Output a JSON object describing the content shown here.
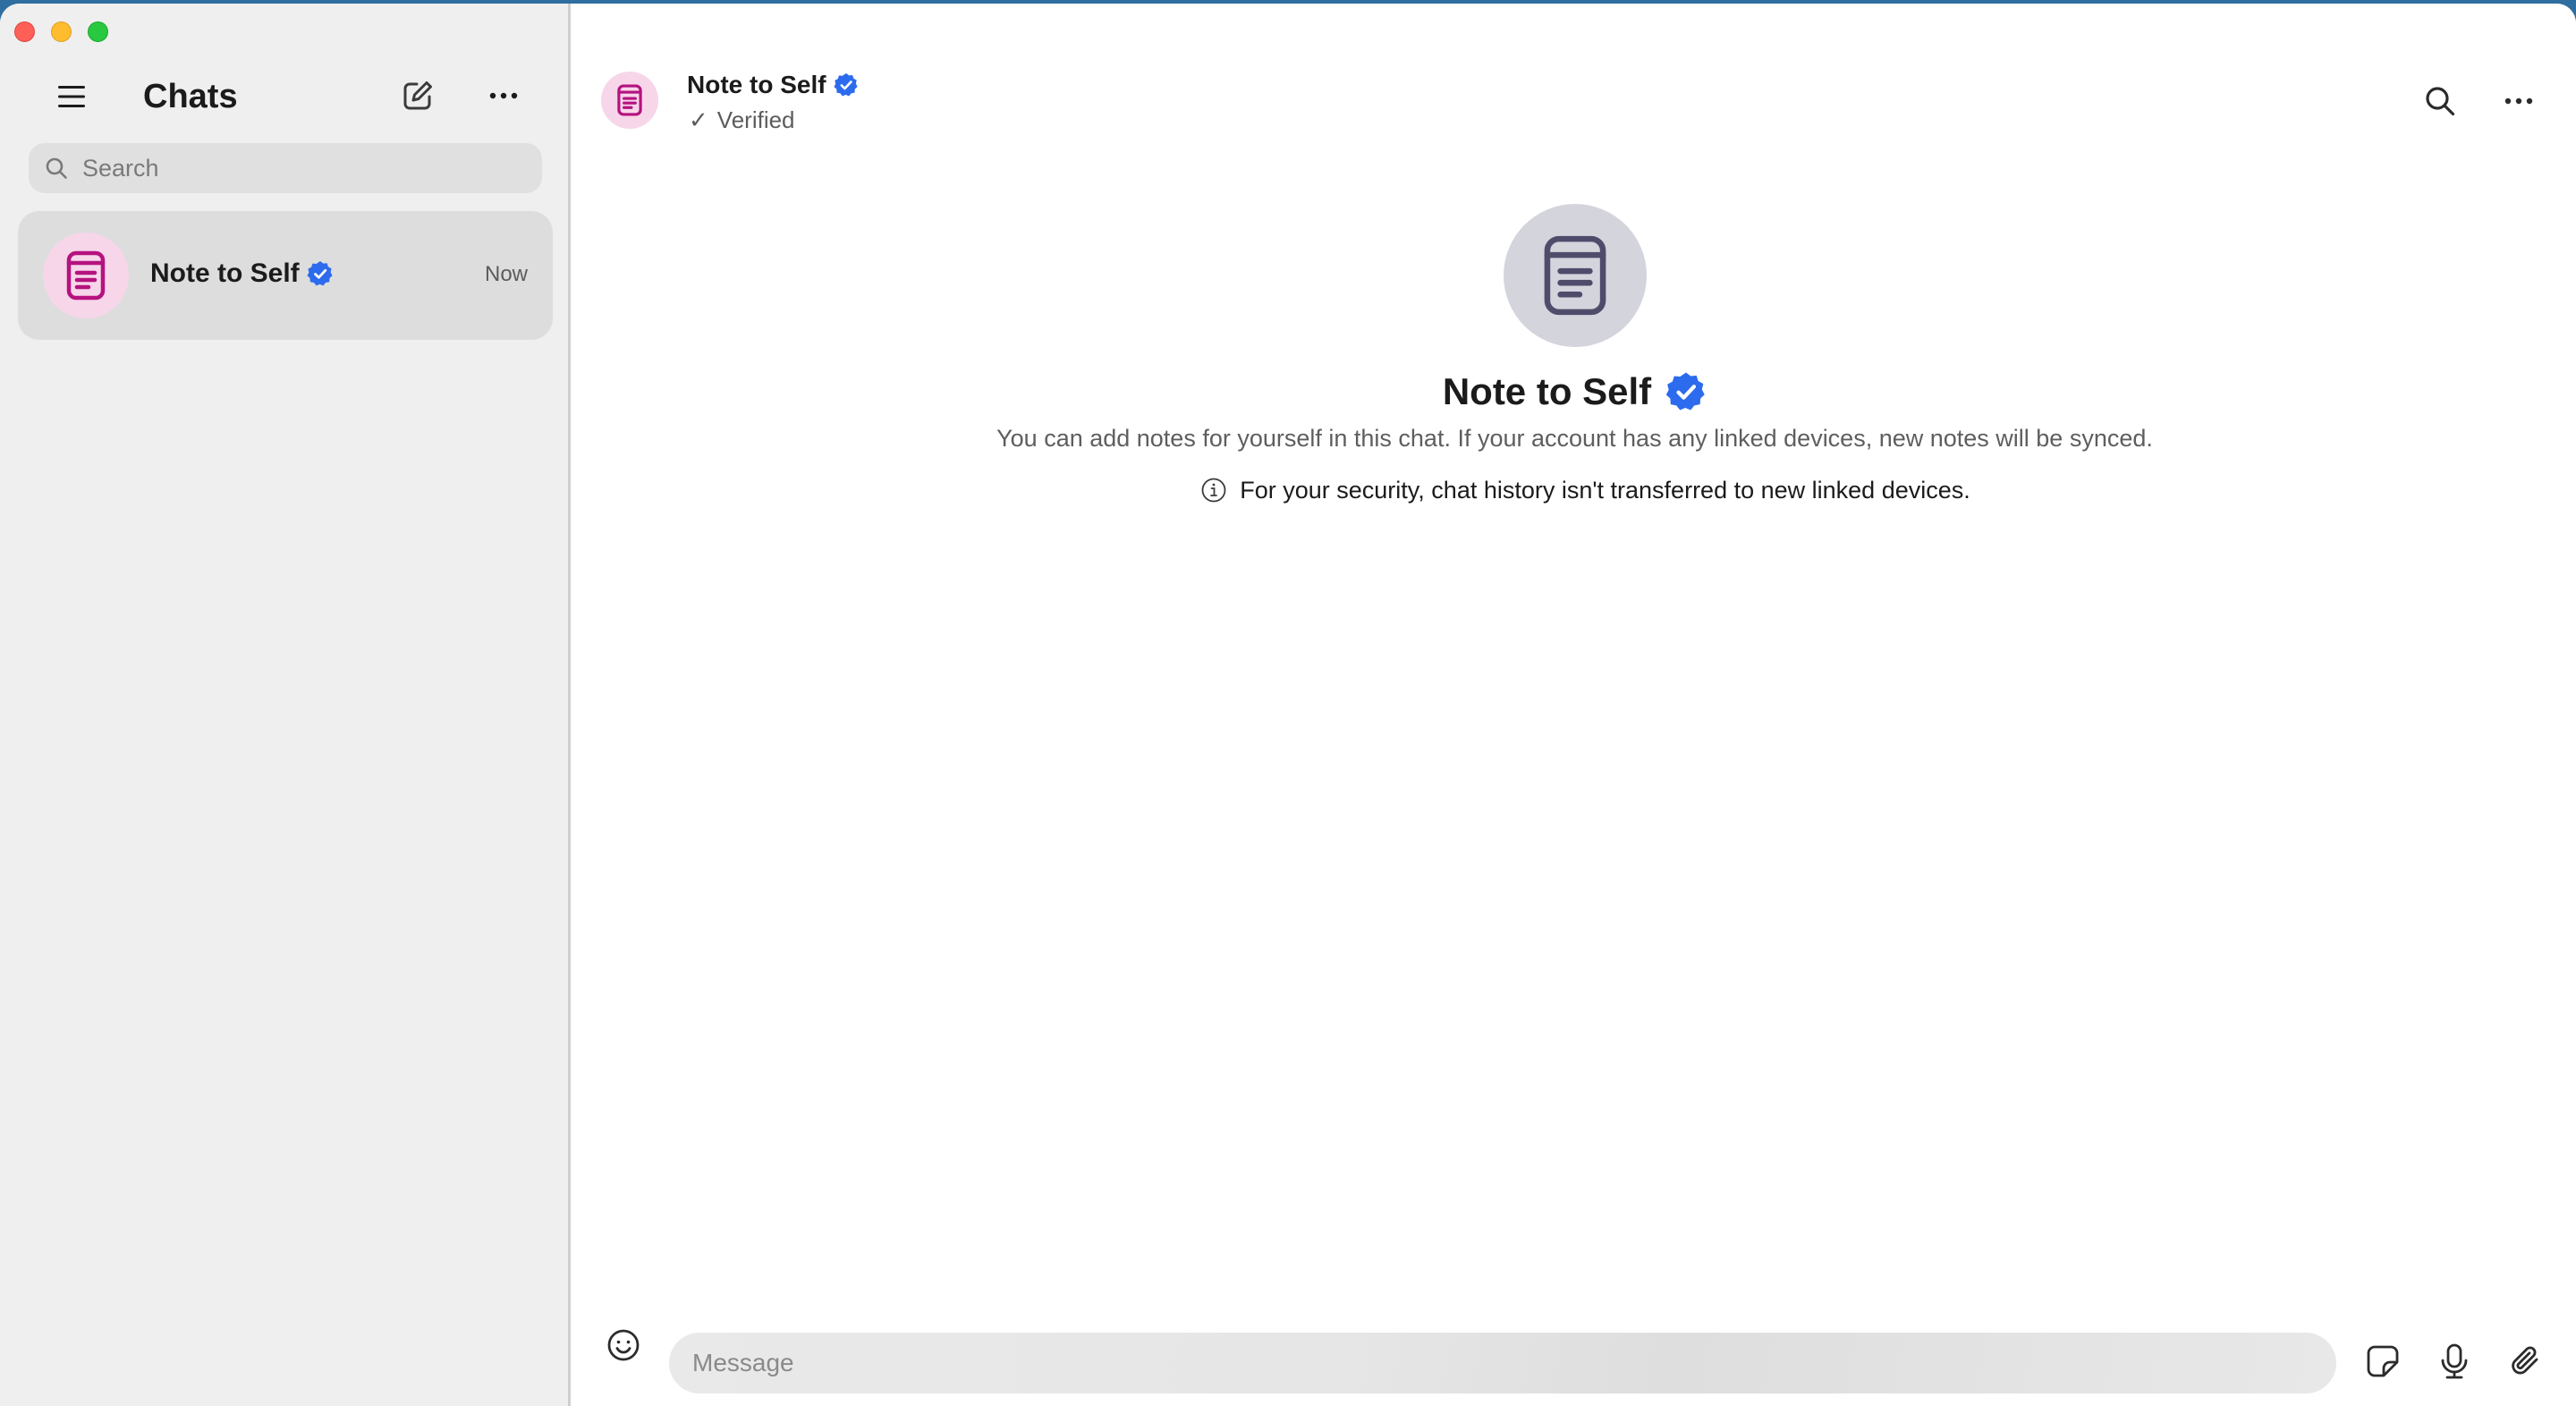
{
  "window": {
    "traffic_lights": [
      "close",
      "minimize",
      "maximize"
    ]
  },
  "sidebar": {
    "title": "Chats",
    "icons": {
      "menu": "hamburger-icon",
      "compose": "compose-icon",
      "more": "more-horizontal-icon"
    },
    "search": {
      "placeholder": "Search",
      "value": ""
    },
    "chats": [
      {
        "name": "Note to Self",
        "verified": true,
        "time": "Now",
        "avatar_icon": "note-icon",
        "selected": true
      }
    ]
  },
  "conversation": {
    "header": {
      "title": "Note to Self",
      "verified": true,
      "subtitle_icon": "✓",
      "subtitle": "Verified",
      "icons": {
        "search": "search-icon",
        "more": "more-horizontal-icon"
      }
    },
    "hero": {
      "title": "Note to Self",
      "description": "You can add notes for yourself in this chat. If your account has any linked devices, new notes will be synced.",
      "security_note": "For your security, chat history isn't transferred to new linked devices."
    },
    "composer": {
      "placeholder": "Message",
      "value": "",
      "icons": [
        "emoji-icon",
        "sticker-icon",
        "microphone-icon",
        "paperclip-icon"
      ]
    }
  },
  "colors": {
    "accent_verified": "#2c6bed",
    "note_avatar_bg": "#f7d6ea",
    "note_avatar_fg": "#b5127f",
    "hero_avatar_bg": "#d4d4dd",
    "hero_avatar_fg": "#4f4c6b"
  }
}
